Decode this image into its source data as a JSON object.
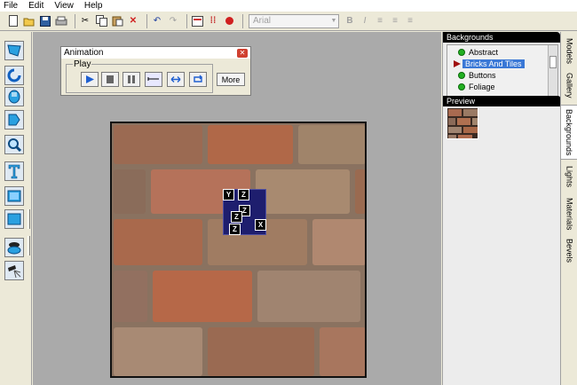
{
  "menu": [
    "File",
    "Edit",
    "View",
    "Help"
  ],
  "toolbar": {
    "buttons": [
      "new-icon",
      "open-icon",
      "save-icon",
      "print-icon",
      "cut-icon",
      "copy-icon",
      "paste-icon",
      "delete-icon",
      "undo-icon",
      "redo-icon",
      "timeline-icon",
      "keyframe-icon",
      "record-icon"
    ],
    "font_name": "Arial",
    "format_buttons": [
      "B",
      "I"
    ]
  },
  "toolbox": {
    "tools": [
      "model-icon",
      "rotate-icon",
      "lathe-icon",
      "extrude-icon",
      "zoom-icon",
      "text-icon",
      "image-icon",
      "shape-icon",
      "camera-icon",
      "light-icon"
    ]
  },
  "animation_dialog": {
    "title": "Animation",
    "group_label": "Play",
    "more_label": "More",
    "buttons": [
      "play-icon",
      "stop-icon",
      "pause-icon",
      "once-icon",
      "pingpong-icon",
      "loop-icon"
    ]
  },
  "handles": [
    "Y",
    "Z",
    "Z",
    "Z",
    "Z",
    "X"
  ],
  "backgrounds": {
    "header": "Backgrounds",
    "items": [
      "Abstract",
      "Bricks And Tiles",
      "Buttons",
      "Foliage"
    ],
    "selected": "Bricks And Tiles"
  },
  "preview": {
    "header": "Preview"
  },
  "side_tabs": [
    "Models",
    "Gallery",
    "Backgrounds",
    "Lights",
    "Materials",
    "Bevels"
  ],
  "colors": {
    "accent": "#3a78d6",
    "brick": "#8a5a44",
    "panel_header": "#000000"
  }
}
